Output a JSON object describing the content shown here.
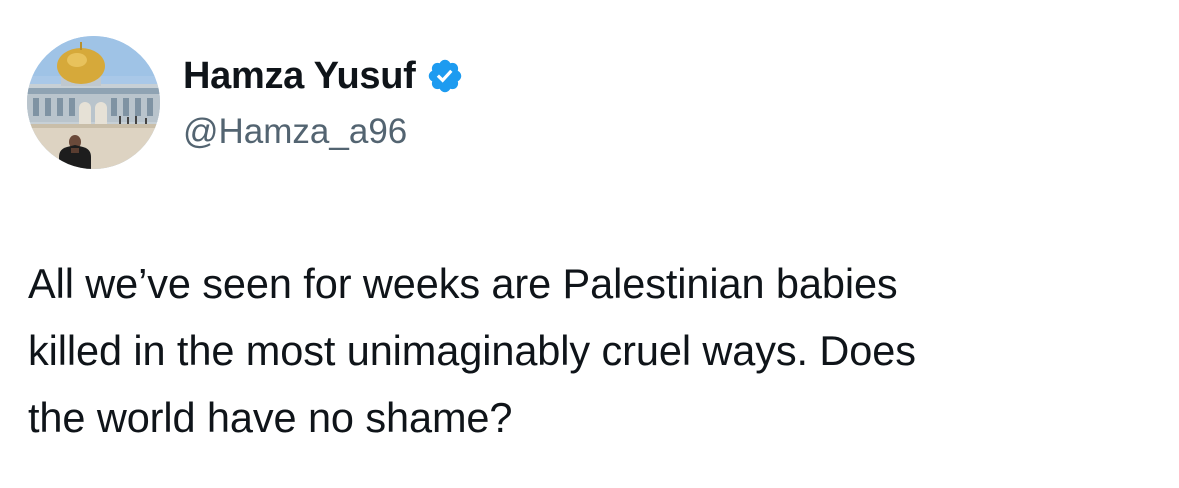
{
  "author": {
    "display_name": "Hamza Yusuf",
    "handle": "@Hamza_a96",
    "verified": true,
    "verified_color": "#1d9bf0",
    "avatar": "profile-photo"
  },
  "tweet": {
    "text": "All we’ve seen for weeks are Palestinian babies\nkilled in the most unimaginably cruel ways. Does\nthe world have no shame?"
  },
  "colors": {
    "text": "#0f1419",
    "secondary_text": "#536471",
    "background": "#ffffff"
  }
}
